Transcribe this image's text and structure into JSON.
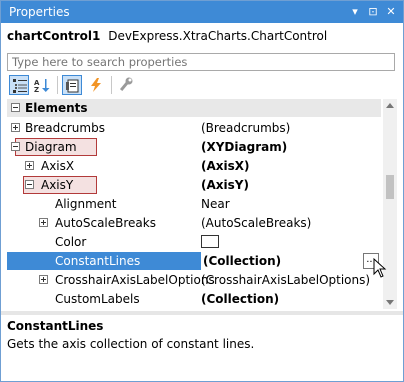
{
  "window": {
    "title": "Properties",
    "dropdown_glyph": "▾",
    "pin_glyph": "⊡",
    "close_glyph": "✕"
  },
  "object_selector": {
    "name": "chartControl1",
    "type": "DevExpress.XtraCharts.ChartControl"
  },
  "search": {
    "placeholder": "Type here to search properties"
  },
  "toolbar": {
    "buttons": [
      {
        "id": "categorized",
        "icon": "categorized-icon",
        "active": true
      },
      {
        "id": "alphabetical",
        "icon": "alphabetical-icon",
        "active": false
      },
      {
        "id": "properties",
        "icon": "properties-icon",
        "active": true
      },
      {
        "id": "events",
        "icon": "lightning-icon",
        "active": false
      },
      {
        "id": "settings",
        "icon": "wrench-icon",
        "active": false
      }
    ]
  },
  "grid": {
    "category": "Elements",
    "rows": [
      {
        "name": "Breadcrumbs",
        "value": "(Breadcrumbs)"
      },
      {
        "name": "Diagram",
        "value": "(XYDiagram)"
      },
      {
        "name": "AxisX",
        "value": "(AxisX)"
      },
      {
        "name": "AxisY",
        "value": "(AxisY)"
      },
      {
        "name": "Alignment",
        "value": "Near"
      },
      {
        "name": "AutoScaleBreaks",
        "value": "(AutoScaleBreaks)"
      },
      {
        "name": "Color",
        "value": ""
      },
      {
        "name": "ConstantLines",
        "value": "(Collection)",
        "ellipsis": "..."
      },
      {
        "name": "CrosshairAxisLabelOptions",
        "value": "(CrosshairAxisLabelOptions)"
      },
      {
        "name": "CustomLabels",
        "value": "(Collection)"
      }
    ]
  },
  "description": {
    "title": "ConstantLines",
    "text": "Gets the axis collection of constant lines."
  },
  "colors": {
    "accent": "#3e8ad6",
    "highlight_border": "#b23a3a",
    "category_bg": "#e8e8e8"
  }
}
